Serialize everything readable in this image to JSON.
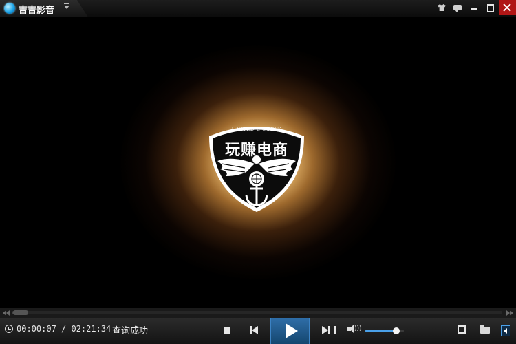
{
  "titlebar": {
    "app_title": "吉吉影音",
    "app_icon": "jijiyingyin-logo-icon",
    "buttons": [
      "skin-icon",
      "feedback-icon",
      "minimize-icon",
      "maximize-icon",
      "close-icon"
    ],
    "close_color": "#b01616"
  },
  "video": {
    "badge_top_text": "UNITED E CORPS",
    "badge_main_text": "玩赚电商"
  },
  "seek": {
    "progress_fraction": 0.0008
  },
  "controls": {
    "current_time": "00:00:07",
    "time_separator": " / ",
    "total_time": "02:21:34",
    "status": "查询成功",
    "volume_fraction": 0.8,
    "accent_color": "#2f6ea8"
  }
}
